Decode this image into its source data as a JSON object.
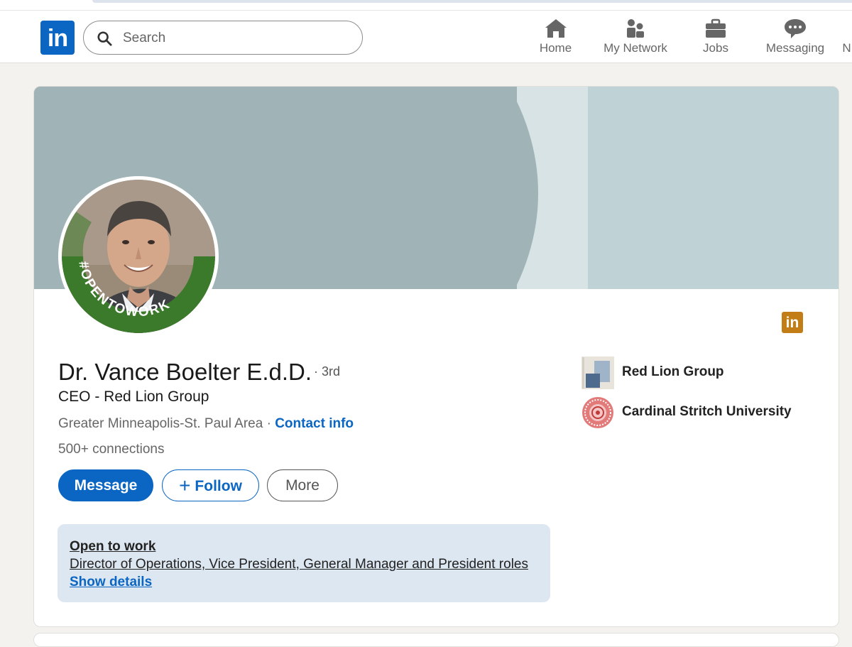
{
  "nav": {
    "logo_text": "in",
    "search_placeholder": "Search",
    "items": [
      {
        "label": "Home",
        "icon": "home-icon"
      },
      {
        "label": "My Network",
        "icon": "network-icon"
      },
      {
        "label": "Jobs",
        "icon": "briefcase-icon"
      },
      {
        "label": "Messaging",
        "icon": "messaging-icon"
      },
      {
        "label": "N"
      }
    ]
  },
  "profile": {
    "name": "Dr. Vance Boelter E.d.D.",
    "degree": "· 3rd",
    "headline": "CEO - Red Lion Group",
    "location": "Greater Minneapolis-St. Paul Area",
    "location_sep": " · ",
    "contact_info": "Contact info",
    "connections": "500+ connections",
    "open_to_work_frame": "#OPENTOWORK",
    "badge_text": "in"
  },
  "actions": {
    "message": "Message",
    "follow": "Follow",
    "more": "More"
  },
  "open_to_work": {
    "title": "Open to work",
    "roles": "Director of Operations, Vice President, General Manager and President roles",
    "show_details": "Show details"
  },
  "side": {
    "company": "Red Lion Group",
    "school": "Cardinal Stritch University"
  },
  "colors": {
    "brand_blue": "#0a66c2",
    "open_to_work_green": "#3b7a2a",
    "premium_gold": "#c37d16"
  }
}
